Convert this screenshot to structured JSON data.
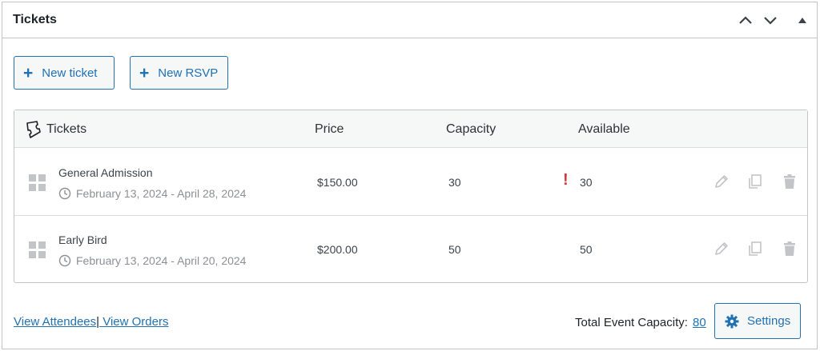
{
  "panel": {
    "title": "Tickets"
  },
  "buttons": {
    "new_ticket": "New ticket",
    "new_rsvp": "New RSVP",
    "plus": "+"
  },
  "table": {
    "columns": {
      "name": "Tickets",
      "price": "Price",
      "capacity": "Capacity",
      "available": "Available"
    },
    "rows": [
      {
        "name": "General Admission",
        "dates": "February 13, 2024 - April 28, 2024",
        "price": "$150.00",
        "capacity": "30",
        "available": "30",
        "warning": "!"
      },
      {
        "name": "Early Bird",
        "dates": "February 13, 2024 - April 20, 2024",
        "price": "$200.00",
        "capacity": "50",
        "available": "50"
      }
    ]
  },
  "footer": {
    "view_attendees": "View Attendees",
    "separator": "|",
    "view_orders": " View Orders",
    "capacity_label": "Total Event Capacity:",
    "capacity_value": "80",
    "settings": "Settings"
  },
  "colors": {
    "accent": "#2271b1",
    "warning": "#d63638",
    "border": "#c3c4c7"
  },
  "icons": [
    "chevron-up-icon",
    "chevron-down-icon",
    "triangle-up-icon",
    "ticket-icon",
    "drag-handle-icon",
    "clock-icon",
    "pencil-icon",
    "duplicate-icon",
    "trash-icon",
    "gear-icon"
  ]
}
